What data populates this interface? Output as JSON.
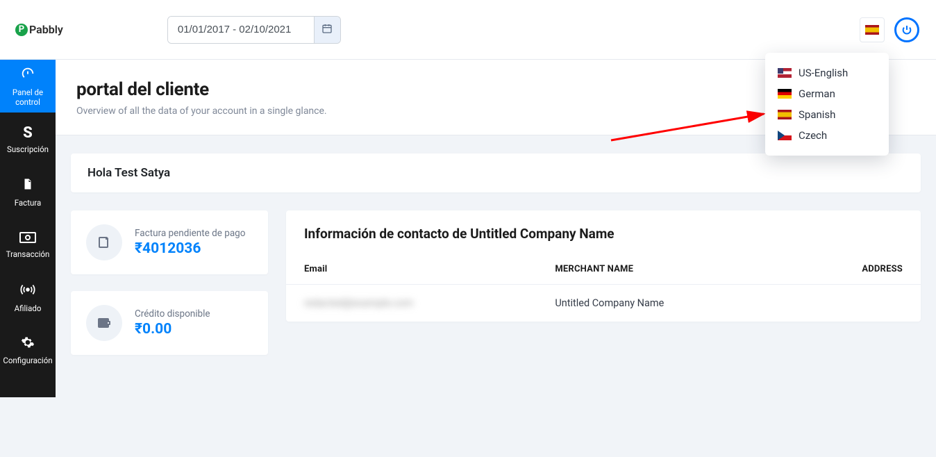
{
  "brand": {
    "name": "Pabbly",
    "mark": "P"
  },
  "topbar": {
    "date_range": "01/01/2017 - 02/10/2021",
    "current_flag": "es"
  },
  "lang_dropdown": {
    "items": [
      {
        "flag": "us",
        "label": "US-English"
      },
      {
        "flag": "de",
        "label": "German"
      },
      {
        "flag": "es",
        "label": "Spanish"
      },
      {
        "flag": "cz",
        "label": "Czech"
      }
    ]
  },
  "sidebar": {
    "items": [
      {
        "icon": "gauge",
        "label": "Panel de control",
        "active": true
      },
      {
        "icon": "s-letter",
        "label": "Suscripción",
        "active": false
      },
      {
        "icon": "file",
        "label": "Factura",
        "active": false
      },
      {
        "icon": "money",
        "label": "Transacción",
        "active": false
      },
      {
        "icon": "broadcast",
        "label": "Afiliado",
        "active": false
      },
      {
        "icon": "gear",
        "label": "Configuración",
        "active": false
      }
    ]
  },
  "header": {
    "title": "portal del cliente",
    "subtitle": "Overview of all the data of your account in a single glance."
  },
  "greeting": "Hola Test Satya",
  "stats": {
    "unpaid": {
      "label": "Factura pendiente de pago",
      "value": "₹4012036"
    },
    "credit": {
      "label": "Crédito disponible",
      "value": "₹0.00"
    }
  },
  "contact": {
    "panel_title": "Información de contacto de Untitled Company Name",
    "columns": {
      "email": "Email",
      "merchant": "MERCHANT NAME",
      "address": "ADDRESS"
    },
    "row": {
      "email_redacted": "redacted@example.com",
      "merchant": "Untitled Company Name",
      "address": ""
    }
  }
}
